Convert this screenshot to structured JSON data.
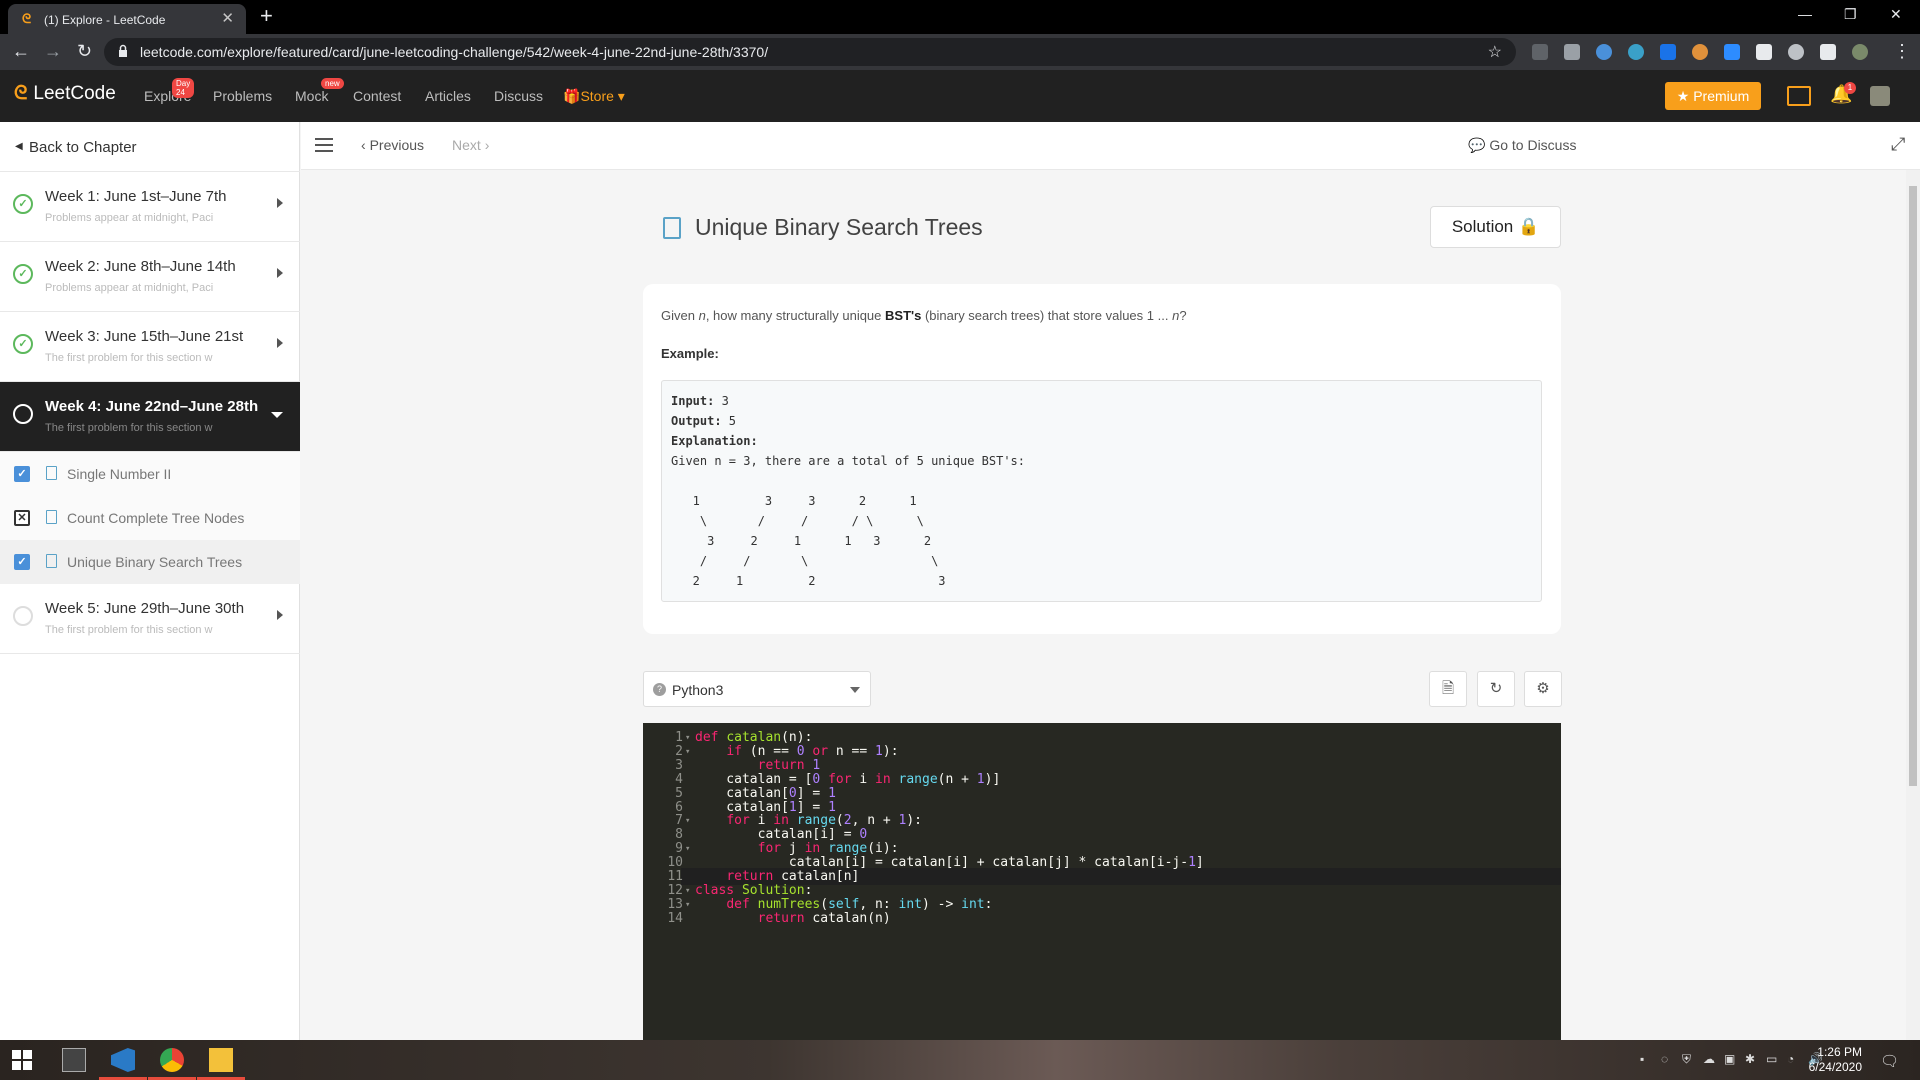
{
  "browser": {
    "tab_title": "(1) Explore - LeetCode",
    "url": "leetcode.com/explore/featured/card/june-leetcoding-challenge/542/week-4-june-22nd-june-28th/3370/"
  },
  "lc_nav": {
    "logo": "LeetCode",
    "links": [
      {
        "label": "Explore",
        "badge": "Day 24"
      },
      {
        "label": "Problems",
        "badge": ""
      },
      {
        "label": "Mock",
        "badge": "new"
      },
      {
        "label": "Contest",
        "badge": ""
      },
      {
        "label": "Articles",
        "badge": ""
      },
      {
        "label": "Discuss",
        "badge": ""
      }
    ],
    "store": "Store",
    "premium": "Premium",
    "notification_count": "1"
  },
  "sidebar": {
    "back": "Back to Chapter",
    "weeks": [
      {
        "title": "Week 1: June 1st–June 7th",
        "subtitle": "Problems appear at midnight, Paci"
      },
      {
        "title": "Week 2: June 8th–June 14th",
        "subtitle": "Problems appear at midnight, Paci"
      },
      {
        "title": "Week 3: June 15th–June 21st",
        "subtitle": "The first problem for this section w"
      },
      {
        "title": "Week 4: June 22nd–June 28th",
        "subtitle": "The first problem for this section w"
      },
      {
        "title": "Week 5: June 29th–June 30th",
        "subtitle": "The first problem for this section w"
      }
    ],
    "problems": [
      {
        "title": "Single Number II",
        "status": "done"
      },
      {
        "title": "Count Complete Tree Nodes",
        "status": "failed"
      },
      {
        "title": "Unique Binary Search Trees",
        "status": "done"
      }
    ]
  },
  "topbar": {
    "previous": "Previous",
    "next": "Next",
    "go_to_discuss": "Go to Discuss"
  },
  "problem": {
    "title": "Unique Binary Search Trees",
    "solution_button": "Solution",
    "desc_given": "Given ",
    "desc_n": "n",
    "desc_mid": ", how many structurally unique ",
    "desc_bst": "BST's",
    "desc_end": " (binary search trees) that store values 1 ... ",
    "desc_n2": "n",
    "desc_q": "?",
    "example_label": "Example:",
    "example_lines": [
      "Input: 3",
      "Output: 5",
      "Explanation:",
      "Given n = 3, there are a total of 5 unique BST's:",
      "",
      "   1         3     3      2      1",
      "    \\       /     /      / \\      \\",
      "     3     2     1      1   3      2",
      "    /     /       \\                 \\",
      "   2     1         2                 3"
    ]
  },
  "editor": {
    "language": "Python3",
    "cursor_line": 11,
    "lines": [
      "def catalan(n):",
      "    if (n == 0 or n == 1):",
      "        return 1",
      "    catalan = [0 for i in range(n + 1)]",
      "    catalan[0] = 1",
      "    catalan[1] = 1",
      "    for i in range(2, n + 1):",
      "        catalan[i] = 0",
      "        for j in range(i):",
      "            catalan[i] = catalan[i] + catalan[j] * catalan[i-j-1]",
      "    return catalan[n]",
      "class Solution:",
      "    def numTrees(self, n: int) -> int:",
      "        return catalan(n)"
    ]
  },
  "taskbar": {
    "time": "1:26 PM",
    "date": "6/24/2020"
  },
  "colors": {
    "accent": "#f89f1b",
    "success": "#5cb85c",
    "nav_bg": "#212121",
    "editor_bg": "#272822"
  }
}
